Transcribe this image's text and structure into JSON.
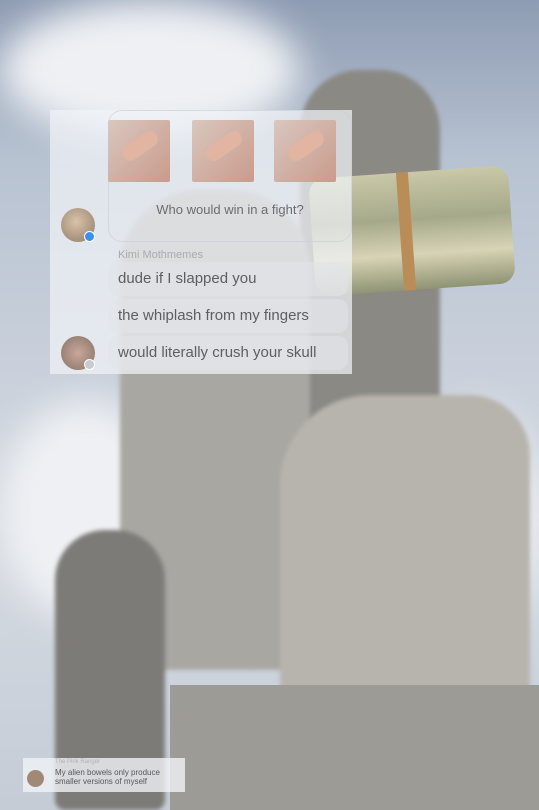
{
  "poll": {
    "question": "Who would win in a fight?",
    "options_icons": [
      "hand-slap-image",
      "hand-slap-image",
      "hand-slap-image"
    ]
  },
  "messages": {
    "sender": "Kimi Mothmemes",
    "lines": [
      "dude if I slapped you",
      "the whiplash from my fingers",
      "would literally crush your skull"
    ]
  },
  "mini_message": {
    "sender": "The Pink Ranger",
    "text": "My alien bowels only produce smaller versions of myself"
  },
  "colors": {
    "messenger_badge": "#3b8fef"
  }
}
